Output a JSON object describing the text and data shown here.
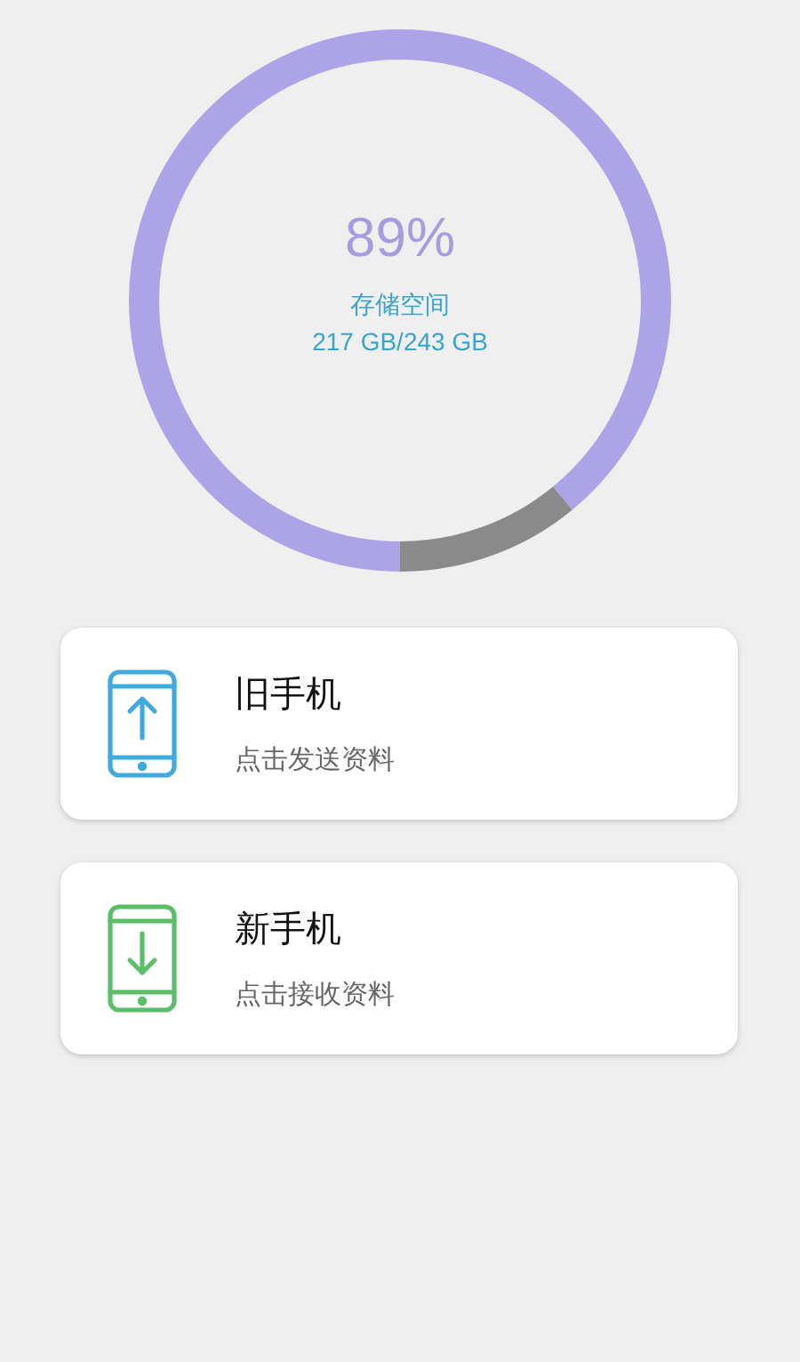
{
  "storage": {
    "percent": "89%",
    "label": "存储空间",
    "usage": "217 GB/243 GB"
  },
  "options": [
    {
      "kind": "send",
      "color": "#3fa9e0",
      "title": "旧手机",
      "subtitle": "点击发送资料"
    },
    {
      "kind": "receive",
      "color": "#5bbf6a",
      "title": "新手机",
      "subtitle": "点击接收资料"
    }
  ]
}
